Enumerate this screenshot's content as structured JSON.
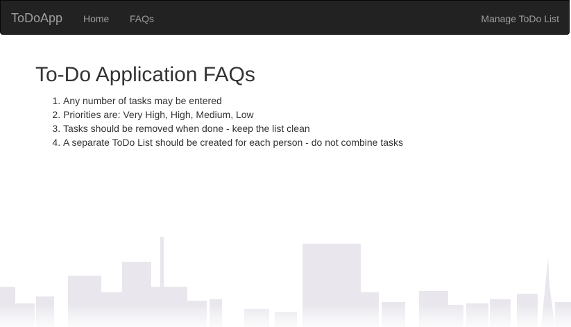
{
  "navbar": {
    "brand": "ToDoApp",
    "links": [
      {
        "label": "Home"
      },
      {
        "label": "FAQs"
      }
    ],
    "right_link": "Manage ToDo List"
  },
  "main": {
    "title": "To-Do Application FAQs",
    "faqs": [
      "Any number of tasks may be entered",
      "Priorities are: Very High, High, Medium, Low",
      "Tasks should be removed when done - keep the list clean",
      "A separate ToDo List should be created for each person - do not combine tasks"
    ]
  },
  "colors": {
    "navbar_bg": "#222222",
    "nav_text": "#9d9d9d",
    "body_text": "#333333",
    "skyline": "#e9e7ed"
  }
}
